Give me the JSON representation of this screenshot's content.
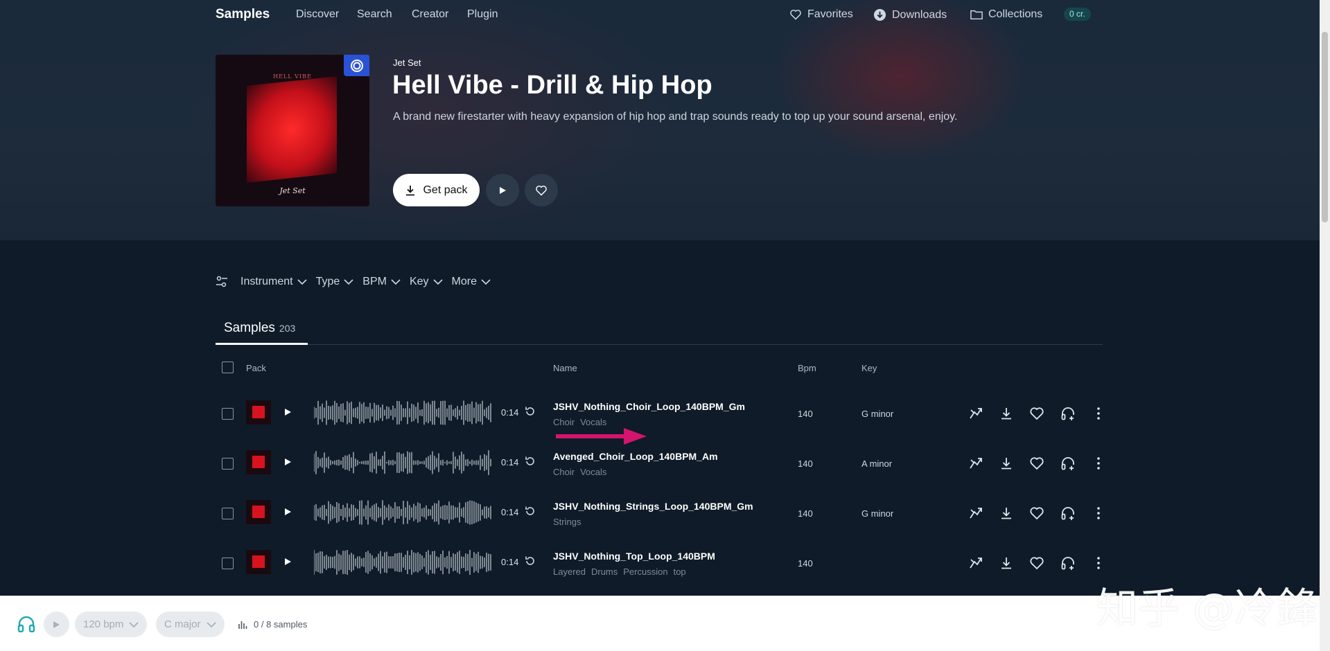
{
  "nav": {
    "logo": "Samples",
    "links": [
      "Discover",
      "Search",
      "Creator",
      "Plugin"
    ],
    "favorites": "Favorites",
    "downloads": "Downloads",
    "collections": "Collections",
    "credits": "0 cr."
  },
  "pack": {
    "publisher": "Jet Set",
    "title": "Hell Vibe - Drill & Hip Hop",
    "description": "A brand new firestarter with heavy expansion of hip hop and trap sounds ready to top up your sound arsenal, enjoy.",
    "get_pack": "Get pack",
    "cover_title": "HELL VIBE",
    "cover_signature": "Jet Set"
  },
  "filters": [
    "Instrument",
    "Type",
    "BPM",
    "Key",
    "More"
  ],
  "tabs": {
    "samples_label": "Samples",
    "samples_count": "203"
  },
  "table": {
    "headers": {
      "pack": "Pack",
      "name": "Name",
      "bpm": "Bpm",
      "key": "Key"
    },
    "rows": [
      {
        "duration": "0:14",
        "name": "JSHV_Nothing_Choir_Loop_140BPM_Gm",
        "tags": [
          "Choir",
          "Vocals"
        ],
        "bpm": "140",
        "key": "G minor"
      },
      {
        "duration": "0:14",
        "name": "Avenged_Choir_Loop_140BPM_Am",
        "tags": [
          "Choir",
          "Vocals"
        ],
        "bpm": "140",
        "key": "A minor"
      },
      {
        "duration": "0:14",
        "name": "JSHV_Nothing_Strings_Loop_140BPM_Gm",
        "tags": [
          "Strings"
        ],
        "bpm": "140",
        "key": "G minor"
      },
      {
        "duration": "0:14",
        "name": "JSHV_Nothing_Top_Loop_140BPM",
        "tags": [
          "Layered",
          "Drums",
          "Percussion",
          "top"
        ],
        "bpm": "140",
        "key": ""
      }
    ]
  },
  "player": {
    "bpm": "120 bpm",
    "key": "C major",
    "samples": "0 / 8 samples"
  },
  "watermark": "知乎 @冷鋒",
  "colors": {
    "accent_badge": "#2a52d6",
    "annotation_arrow": "#d4146e",
    "credits_badge": "#16464d"
  }
}
